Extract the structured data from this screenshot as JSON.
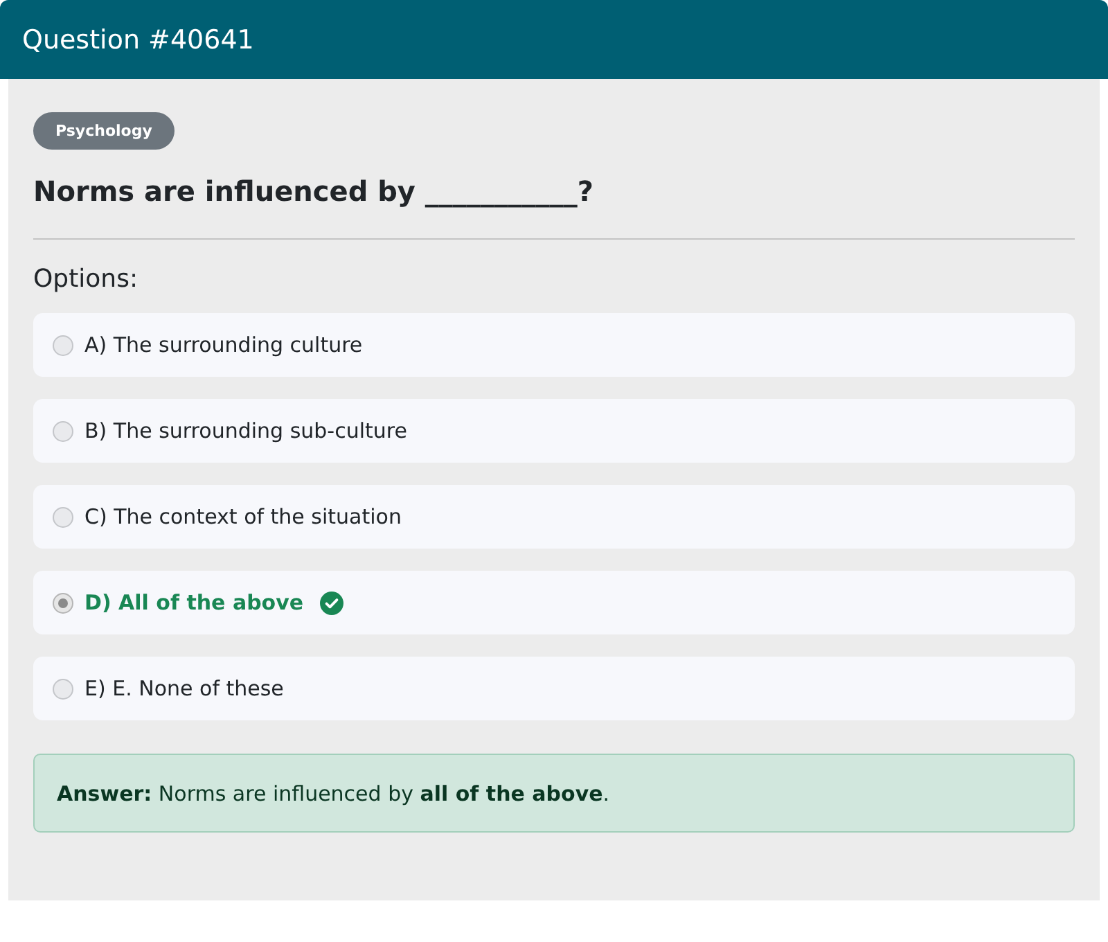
{
  "header": {
    "title": "Question #40641"
  },
  "category": "Psychology",
  "question": "Norms are influenced by ___________?",
  "options_label": "Options:",
  "options": [
    {
      "text": "A) The surrounding culture",
      "selected": false,
      "correct": false
    },
    {
      "text": "B) The surrounding sub-culture",
      "selected": false,
      "correct": false
    },
    {
      "text": "C) The context of the situation",
      "selected": false,
      "correct": false
    },
    {
      "text": "D) All of the above",
      "selected": true,
      "correct": true
    },
    {
      "text": "E) E. None of these",
      "selected": false,
      "correct": false
    }
  ],
  "answer": "**Answer:** Norms are influenced by **all of the above**."
}
